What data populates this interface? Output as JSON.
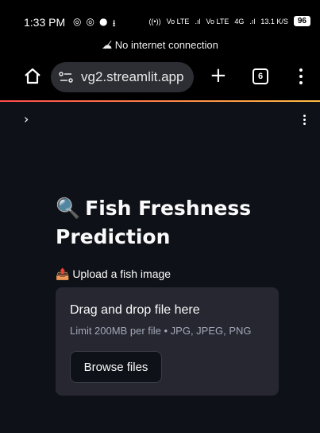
{
  "status_bar": {
    "time": "1:33 PM",
    "left_icons": [
      "instagram-icon",
      "instagram-icon",
      "chat-icon",
      "download-icon"
    ],
    "right_text": [
      "((•))",
      "Vo LTE",
      ".ıl",
      "Vo LTE",
      "4G",
      ".ıl",
      "13.1 K/S"
    ],
    "battery": "96"
  },
  "banner": {
    "text": "No internet connection",
    "icon": "cloud-off-icon"
  },
  "browser": {
    "url": "vg2.streamlit.app",
    "tab_count": "6",
    "accent_colors": [
      "#ff4b4b",
      "#ffbd45"
    ]
  },
  "app": {
    "title_icon": "🔍",
    "title": "Fish Freshness Prediction",
    "upload_label": "📤 Upload a fish image",
    "dropzone": {
      "title": "Drag and drop file here",
      "limit": "Limit 200MB per file • JPG, JPEG, PNG",
      "button": "Browse files"
    }
  }
}
